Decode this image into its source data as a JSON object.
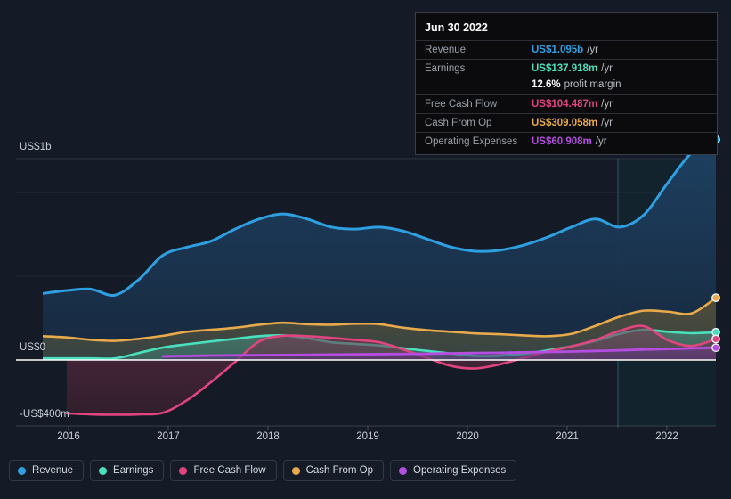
{
  "tooltip": {
    "date": "Jun 30 2022",
    "rows": [
      {
        "label": "Revenue",
        "value": "US$1.095b",
        "unit": "/yr",
        "color": "#2e9fe0"
      },
      {
        "label": "Earnings",
        "value": "US$137.918m",
        "unit": "/yr",
        "color": "#4ae0bd"
      },
      {
        "label": "Free Cash Flow",
        "value": "US$104.487m",
        "unit": "/yr",
        "color": "#e0457f"
      },
      {
        "label": "Cash From Op",
        "value": "US$309.058m",
        "unit": "/yr",
        "color": "#e8aa4a"
      },
      {
        "label": "Operating Expenses",
        "value": "US$60.908m",
        "unit": "/yr",
        "color": "#b44de0"
      }
    ],
    "margin_value": "12.6%",
    "margin_text": "profit margin"
  },
  "legend": {
    "items": [
      {
        "label": "Revenue",
        "color": "#2e9fe0"
      },
      {
        "label": "Earnings",
        "color": "#4ae0bd"
      },
      {
        "label": "Free Cash Flow",
        "color": "#e0457f"
      },
      {
        "label": "Cash From Op",
        "color": "#e8aa4a"
      },
      {
        "label": "Operating Expenses",
        "color": "#b44de0"
      }
    ]
  },
  "axis": {
    "y_top": "US$1b",
    "y_zero": "US$0",
    "y_bottom": "-US$400m",
    "x_ticks": [
      "2016",
      "2017",
      "2018",
      "2019",
      "2020",
      "2021",
      "2022"
    ]
  },
  "chart_data": {
    "type": "area",
    "title": "",
    "xlabel": "",
    "ylabel": "",
    "ylim": [
      -400,
      1000
    ],
    "y_unit": "US$ millions",
    "grid": true,
    "legend_position": "bottom",
    "x_tick_labels": [
      "2016",
      "2017",
      "2018",
      "2019",
      "2020",
      "2021",
      "2022"
    ],
    "x_tick_positions": [
      77,
      189,
      301,
      413,
      525,
      637,
      749
    ],
    "forecast_start_x": 694,
    "x": [
      2015.62,
      2015.87,
      2016.12,
      2016.37,
      2016.62,
      2016.87,
      2017.12,
      2017.37,
      2017.62,
      2017.87,
      2018.12,
      2018.37,
      2018.62,
      2018.87,
      2019.12,
      2019.37,
      2019.62,
      2019.87,
      2020.12,
      2020.37,
      2020.62,
      2020.87,
      2021.12,
      2021.37,
      2021.62,
      2021.87,
      2022.12,
      2022.37,
      2022.62
    ],
    "series": [
      {
        "name": "Revenue",
        "color": "#2e9fe0",
        "fill": "#1a3450",
        "values": [
          330,
          345,
          352,
          322,
          400,
          520,
          560,
          590,
          650,
          700,
          725,
          700,
          660,
          650,
          660,
          640,
          600,
          560,
          540,
          545,
          570,
          610,
          660,
          700,
          660,
          720,
          880,
          1030,
          1095
        ]
      },
      {
        "name": "Cash From Op",
        "color": "#e8aa4a",
        "fill": "#4a4433",
        "values": [
          118,
          112,
          100,
          95,
          105,
          120,
          140,
          150,
          160,
          175,
          185,
          178,
          175,
          180,
          178,
          160,
          148,
          140,
          132,
          128,
          122,
          118,
          130,
          170,
          215,
          245,
          240,
          232,
          309
        ]
      },
      {
        "name": "Earnings",
        "color": "#4ae0bd",
        "fill": "#2e5a52",
        "values": [
          8,
          8,
          8,
          8,
          35,
          62,
          78,
          92,
          105,
          118,
          122,
          108,
          88,
          80,
          72,
          58,
          45,
          32,
          20,
          22,
          30,
          48,
          68,
          95,
          130,
          150,
          140,
          133,
          138
        ]
      },
      {
        "name": "Free Cash Flow",
        "color": "#e0457f",
        "fill": "#3a1f2b",
        "values": [
          null,
          -265,
          -270,
          -272,
          -270,
          -262,
          -200,
          -110,
          -10,
          92,
          120,
          118,
          110,
          100,
          88,
          52,
          10,
          -30,
          -42,
          -22,
          10,
          42,
          68,
          100,
          145,
          168,
          98,
          70,
          104
        ]
      },
      {
        "name": "Operating Expenses",
        "color": "#b44de0",
        "fill": "#4a2a5e",
        "values": [
          null,
          null,
          null,
          null,
          null,
          18,
          20,
          22,
          23,
          24,
          25,
          26,
          27,
          28,
          29,
          30,
          31,
          33,
          35,
          36,
          38,
          40,
          42,
          45,
          48,
          52,
          55,
          58,
          61
        ]
      }
    ]
  }
}
